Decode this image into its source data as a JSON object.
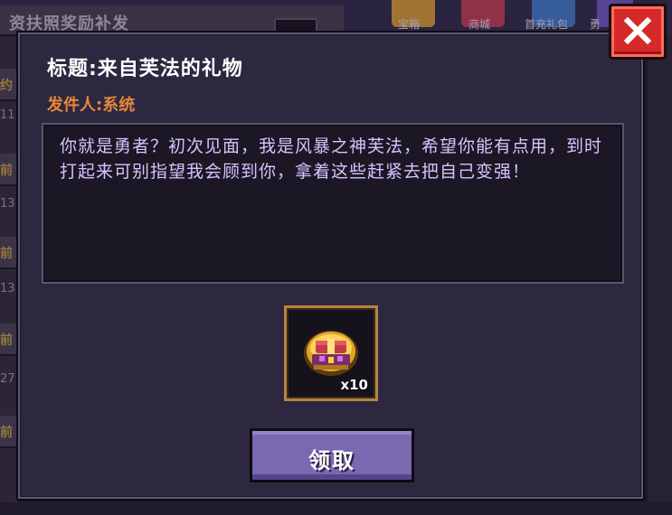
{
  "background": {
    "header_text": "资扶照奖励补发",
    "left_chars": [
      "约",
      "前",
      "前",
      "前",
      "前"
    ],
    "left_numbers": [
      "11",
      "13",
      "13",
      "13",
      "27"
    ],
    "top_icons": [
      {
        "label": "宝箱"
      },
      {
        "label": "商城"
      },
      {
        "label": "首充礼包"
      },
      {
        "label": "勇"
      }
    ]
  },
  "dialog": {
    "title": "标题:来自芙法的礼物",
    "sender": "发件人:系统",
    "message": "你就是勇者？初次见面，我是风暴之神芙法，希望你能有点用，到时打起来可别指望我会顾到你，拿着这些赶紧去把自己变强！",
    "reward": {
      "icon": "treasure-chest-icon",
      "quantity": "x10"
    },
    "claim_button": "领取",
    "close_icon": "close-icon"
  },
  "colors": {
    "dialog_bg": "#2d2840",
    "title": "#ffffff",
    "sender": "#e8863a",
    "message": "#d6c3ff",
    "button": "#7a68b0",
    "close_button": "#d62a2a",
    "slot_border": "#b5853b"
  }
}
